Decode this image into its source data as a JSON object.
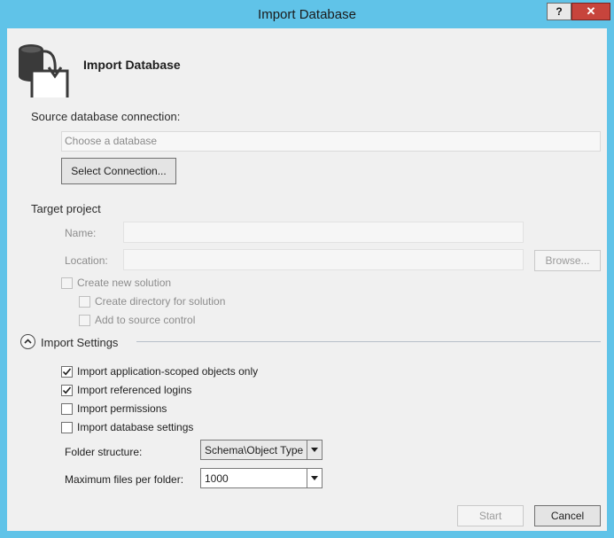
{
  "window": {
    "title": "Import Database",
    "help_label": "?",
    "close_label": "✕"
  },
  "header": {
    "title": "Import Database",
    "icon": "database-import-icon"
  },
  "source": {
    "label": "Source database connection:",
    "database_placeholder": "Choose a database",
    "select_connection_label": "Select Connection..."
  },
  "target": {
    "label": "Target project",
    "name_label": "Name:",
    "name_value": "",
    "location_label": "Location:",
    "location_value": "",
    "browse_label": "Browse...",
    "create_new_solution": {
      "label": "Create new solution",
      "checked": false,
      "enabled": false
    },
    "create_directory": {
      "label": "Create directory for solution",
      "checked": false,
      "enabled": false
    },
    "add_source_control": {
      "label": "Add to source control",
      "checked": false,
      "enabled": false
    }
  },
  "import_settings": {
    "label": "Import Settings",
    "expanded": true,
    "options": [
      {
        "label": "Import application-scoped objects only",
        "checked": true
      },
      {
        "label": "Import referenced logins",
        "checked": true
      },
      {
        "label": "Import permissions",
        "checked": false
      },
      {
        "label": "Import database settings",
        "checked": false
      }
    ],
    "folder_structure_label": "Folder structure:",
    "folder_structure_value": "Schema\\Object Type",
    "max_files_label": "Maximum files per folder:",
    "max_files_value": "1000"
  },
  "footer": {
    "start_label": "Start",
    "cancel_label": "Cancel"
  },
  "colors": {
    "title_bar": "#60c3e8",
    "close_button": "#c7443c",
    "dialog_background": "#f0f0f0"
  }
}
